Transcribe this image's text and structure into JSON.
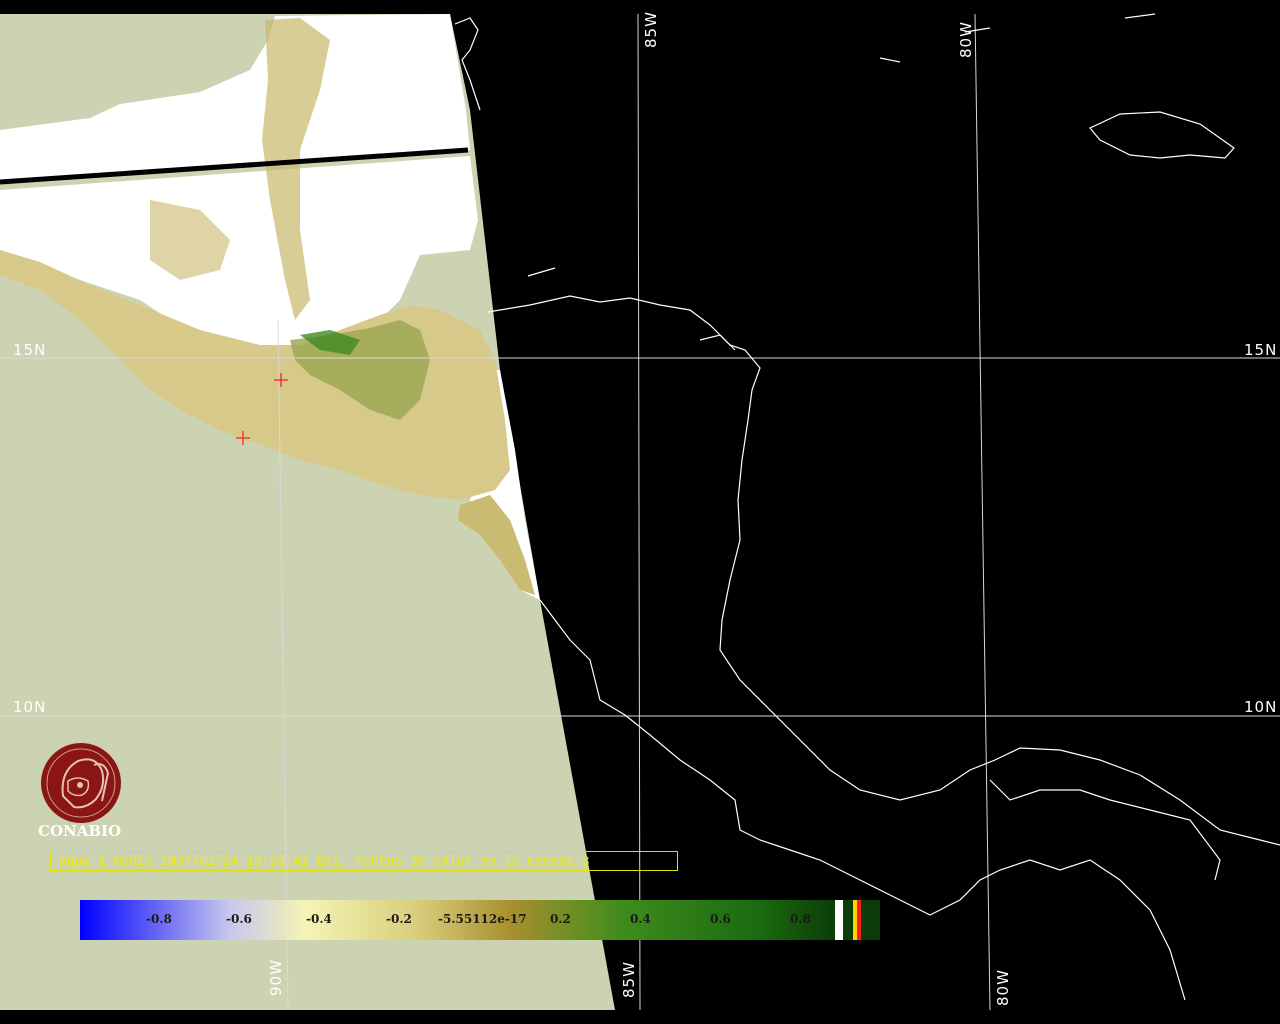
{
  "map": {
    "grid_labels": {
      "lat_15_left": "15N",
      "lat_15_right": "15N",
      "lat_10_left": "10N",
      "lat_10_right": "10N",
      "lon_85_top": "85W",
      "lon_80_top": "80W",
      "lon_90_bottom": "90W",
      "lon_85_bottom": "85W",
      "lon_80_bottom": "80W"
    },
    "hotspot_count": 2,
    "hotspot_marker": "red-cross"
  },
  "logo": {
    "icon": "conabio-logo-icon",
    "text": "CONABIO"
  },
  "caption": {
    "text": "aqua-1 modis 2007/01/24 19:53:42 EVI, Puntos de calor en la escena 3"
  },
  "colorbar": {
    "ticks": [
      "-0.8",
      "-0.6",
      "-0.4",
      "-0.2",
      "-5.55112e-17",
      "0.2",
      "0.4",
      "0.6",
      "0.8"
    ],
    "colors": [
      "#0000ff",
      "#c8c8ee",
      "#f4f4b4",
      "#a8902e",
      "#2a8a18",
      "#0c3c08"
    ]
  }
}
